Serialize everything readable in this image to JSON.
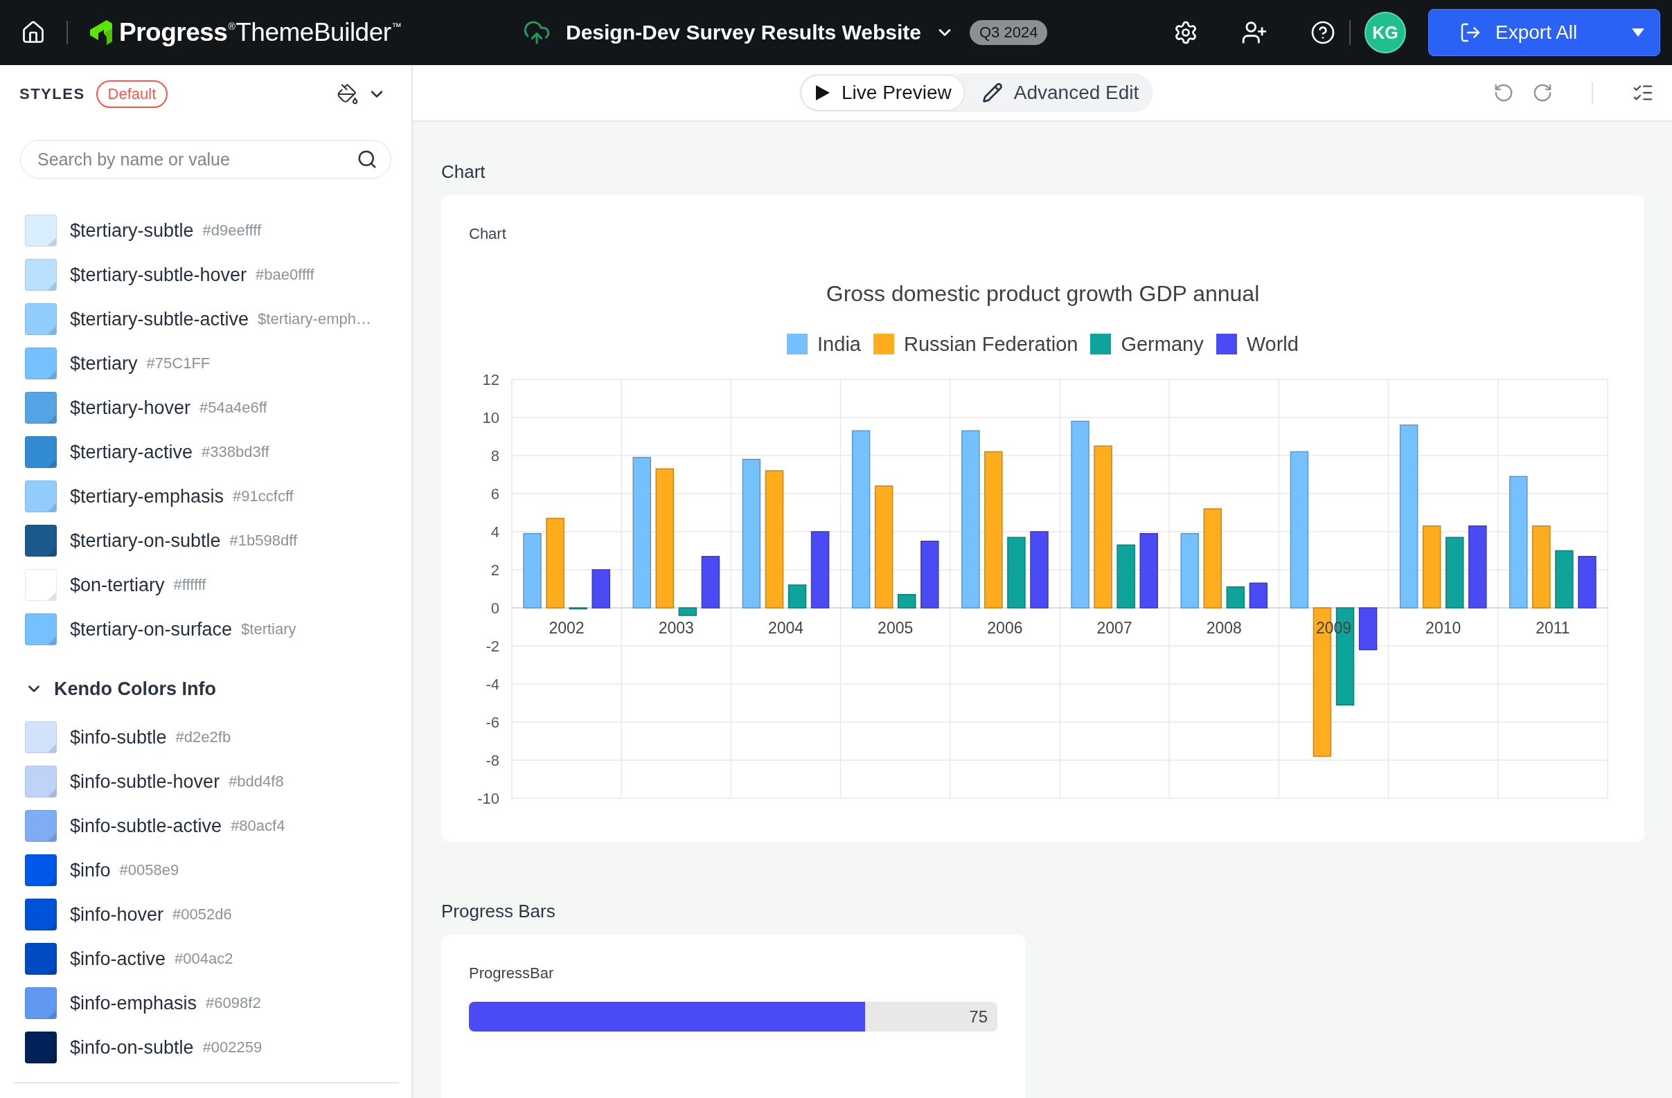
{
  "header": {
    "logo_text": "**Progress**$^{®}$ThemeBuilder$^{™}$",
    "project_title": "Design-Dev Survey Results Website",
    "badge": "Q3 2024",
    "avatar": "KG",
    "export_button": "Export All"
  },
  "sidebar": {
    "title": "STYLES",
    "style_badge": "Default",
    "search": {
      "placeholder": "Search by name or value"
    },
    "groups": [
      {
        "items": [
          {
            "name": "$tertiary-subtle",
            "value": "#d9eeffff",
            "color": "#d9eeff"
          },
          {
            "name": "$tertiary-subtle-hover",
            "value": "#bae0ffff",
            "color": "#bae0ff"
          },
          {
            "name": "$tertiary-subtle-active",
            "value": "$tertiary-emph…",
            "color": "#91ccfc"
          },
          {
            "name": "$tertiary",
            "value": "#75C1FF",
            "color": "#75c1ff"
          },
          {
            "name": "$tertiary-hover",
            "value": "#54a4e6ff",
            "color": "#54a4e6"
          },
          {
            "name": "$tertiary-active",
            "value": "#338bd3ff",
            "color": "#338bd3"
          },
          {
            "name": "$tertiary-emphasis",
            "value": "#91ccfcff",
            "color": "#91ccfc"
          },
          {
            "name": "$tertiary-on-subtle",
            "value": "#1b598dff",
            "color": "#1b598d"
          },
          {
            "name": "$on-tertiary",
            "value": "#ffffff",
            "color": "#ffffff"
          },
          {
            "name": "$tertiary-on-surface",
            "value": "$tertiary",
            "color": "#75c1ff"
          }
        ]
      },
      {
        "title": "Kendo Colors Info",
        "expanded": true,
        "items": [
          {
            "name": "$info-subtle",
            "value": "#d2e2fb",
            "color": "#d2e2fb"
          },
          {
            "name": "$info-subtle-hover",
            "value": "#bdd4f8",
            "color": "#bdd4f8"
          },
          {
            "name": "$info-subtle-active",
            "value": "#80acf4",
            "color": "#80acf4"
          },
          {
            "name": "$info",
            "value": "#0058e9",
            "color": "#0058e9"
          },
          {
            "name": "$info-hover",
            "value": "#0052d6",
            "color": "#0052d6"
          },
          {
            "name": "$info-active",
            "value": "#004ac2",
            "color": "#004ac2"
          },
          {
            "name": "$info-emphasis",
            "value": "#6098f2",
            "color": "#6098f2"
          },
          {
            "name": "$info-on-subtle",
            "value": "#002259",
            "color": "#002259"
          }
        ]
      }
    ]
  },
  "toolbar": {
    "modes": [
      {
        "label": "Live Preview",
        "kind": "preview",
        "selected": true
      },
      {
        "label": "Advanced Edit",
        "kind": "edit",
        "selected": false
      }
    ]
  },
  "sections": [
    {
      "kind": "chart",
      "heading": "Chart",
      "card_title": "Chart",
      "chart_data": {
        "type": "bar",
        "title": "Gross domestic product growth GDP annual",
        "legend": "top",
        "grid": true,
        "categories": [
          "2002",
          "2003",
          "2004",
          "2005",
          "2006",
          "2007",
          "2008",
          "2009",
          "2010",
          "2011"
        ],
        "series": [
          {
            "name": "India",
            "color": "#75c1ff",
            "values": [
              3.9,
              7.9,
              7.8,
              9.3,
              9.3,
              9.8,
              3.9,
              8.2,
              9.6,
              6.9
            ]
          },
          {
            "name": "Russian Federation",
            "color": "#ffac1f",
            "values": [
              4.7,
              7.3,
              7.2,
              6.4,
              8.2,
              8.5,
              5.2,
              -7.8,
              4.3,
              4.3
            ]
          },
          {
            "name": "Germany",
            "color": "#0ea49c",
            "values": [
              0,
              -0.4,
              1.2,
              0.7,
              3.7,
              3.3,
              1.1,
              -5.1,
              3.7,
              3
            ]
          },
          {
            "name": "World",
            "color": "#4b4bf5",
            "values": [
              2,
              2.7,
              4,
              3.5,
              4,
              3.9,
              1.3,
              -2.2,
              4.3,
              2.7
            ]
          }
        ],
        "ylim": [
          -10,
          12
        ],
        "yticks": [
          -10,
          -8,
          -6,
          -4,
          -2,
          0,
          2,
          4,
          6,
          8,
          10,
          12
        ]
      }
    },
    {
      "kind": "progress",
      "heading": "Progress Bars",
      "card_title": "ProgressBar",
      "level": 0.75,
      "reading": "75"
    }
  ]
}
